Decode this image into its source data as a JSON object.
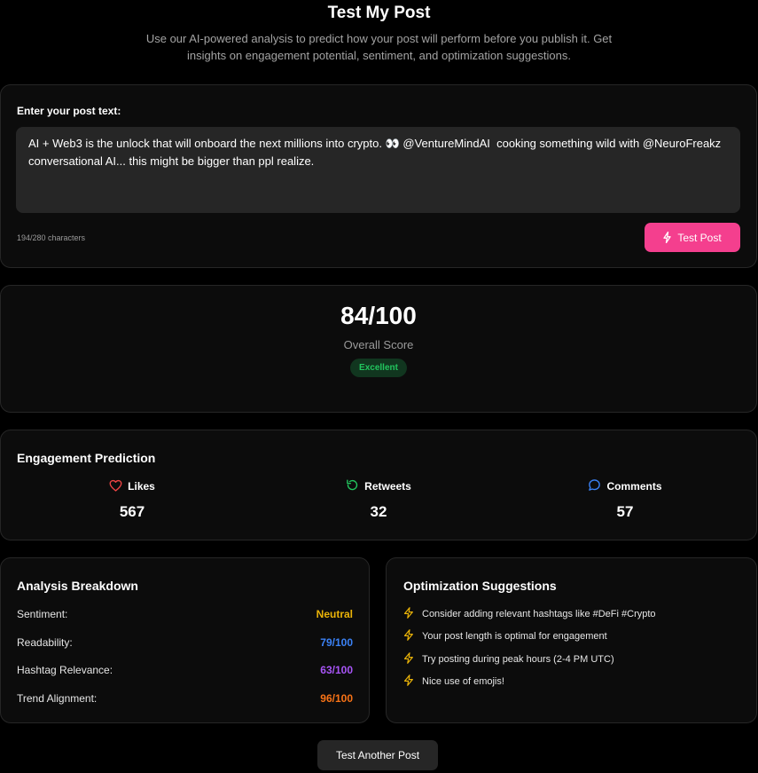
{
  "header": {
    "title": "Test My Post",
    "subtitle": "Use our AI-powered analysis to predict how your post will perform before you publish it. Get insights on engagement potential, sentiment, and optimization suggestions."
  },
  "post_input": {
    "label": "Enter your post text:",
    "value": "AI + Web3 is the unlock that will onboard the next millions into crypto. 👀 @VentureMindAI  cooking something wild with @NeuroFreakz conversational AI... this might be bigger than ppl realize.",
    "char_count": "194/280 characters",
    "button_label": "Test Post",
    "button_color": "#f43f8e"
  },
  "score": {
    "value": "84/100",
    "label": "Overall Score",
    "badge": "Excellent",
    "badge_color": "#22c55e"
  },
  "engagement": {
    "title": "Engagement Prediction",
    "metrics": [
      {
        "label": "Likes",
        "value": "567",
        "icon": "heart-icon",
        "color": "#ef4444"
      },
      {
        "label": "Retweets",
        "value": "32",
        "icon": "retweet-icon",
        "color": "#22c55e"
      },
      {
        "label": "Comments",
        "value": "57",
        "icon": "comment-icon",
        "color": "#3b82f6"
      }
    ]
  },
  "analysis": {
    "title": "Analysis Breakdown",
    "rows": [
      {
        "label": "Sentiment:",
        "value": "Neutral",
        "color": "#eab308"
      },
      {
        "label": "Readability:",
        "value": "79/100",
        "color": "#3b82f6"
      },
      {
        "label": "Hashtag Relevance:",
        "value": "63/100",
        "color": "#a855f7"
      },
      {
        "label": "Trend Alignment:",
        "value": "96/100",
        "color": "#f97316"
      }
    ]
  },
  "suggestions": {
    "title": "Optimization Suggestions",
    "icon": "lightning-icon",
    "icon_color": "#eab308",
    "items": [
      "Consider adding relevant hashtags like #DeFi #Crypto",
      "Your post length is optimal for engagement",
      "Try posting during peak hours (2-4 PM UTC)",
      "Nice use of emojis!"
    ]
  },
  "footer": {
    "button_label": "Test Another Post"
  }
}
